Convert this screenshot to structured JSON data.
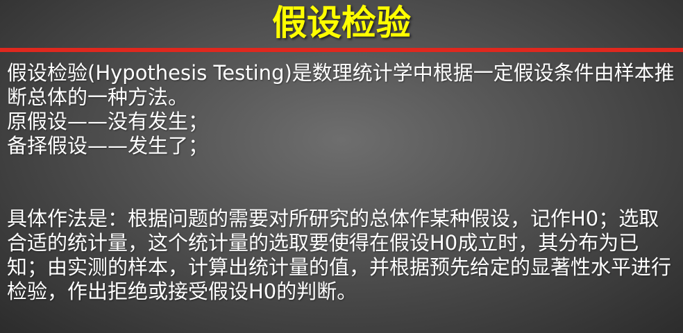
{
  "title": "假设检验",
  "paragraphs": {
    "definition": "假设检验(Hypothesis Testing)是数理统计学中根据一定假设条件由样本推断总体的一种方法。",
    "null_hypothesis": "原假设——没有发生；",
    "alternative_hypothesis": "备择假设——发生了；",
    "procedure": "具体作法是：根据问题的需要对所研究的总体作某种假设，记作H0；选取合适的统计量，这个统计量的选取要使得在假设H0成立时，其分布为已知；由实测的样本，计算出统计量的值，并根据预先给定的显著性水平进行检验，作出拒绝或接受假设H0的判断。"
  },
  "colors": {
    "title": "#ffff00",
    "rule": "#e0281e",
    "text": "#ffffff"
  }
}
